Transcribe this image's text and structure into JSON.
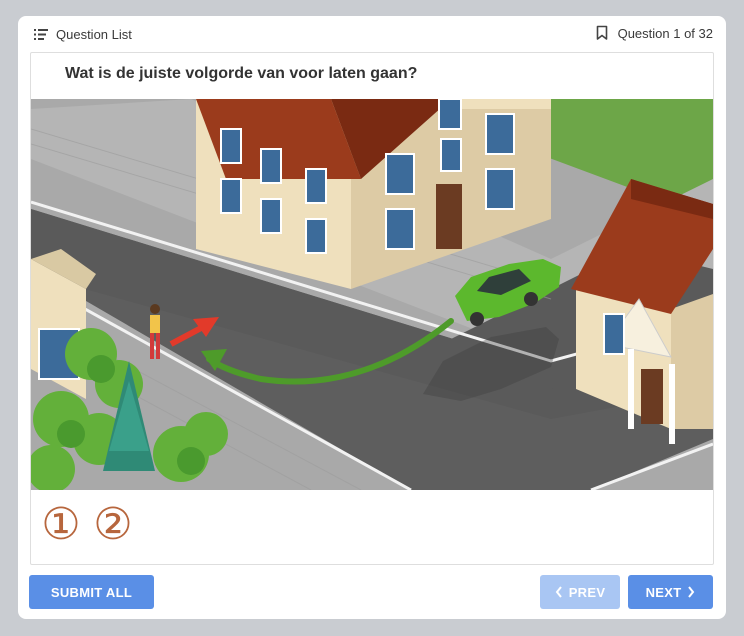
{
  "header": {
    "question_list_label": "Question List",
    "question_counter": "Question 1 of 32"
  },
  "question": {
    "text": "Wat is de juiste volgorde van voor laten gaan?"
  },
  "answers": [
    {
      "label": "①"
    },
    {
      "label": "②"
    }
  ],
  "buttons": {
    "submit_all": "SUBMIT ALL",
    "prev": "PREV",
    "next": "NEXT"
  },
  "colors": {
    "primary": "#5a8fe6",
    "primary_disabled": "#a9c6f3",
    "answer_number": "#b7663d",
    "car": "#5cb82d",
    "arrow_red": "#e23a2a",
    "arrow_green": "#4e9b2a"
  },
  "icons": {
    "list": "list-icon",
    "bookmark": "bookmark-icon",
    "prev": "chevron-left-icon",
    "next": "chevron-right-icon"
  }
}
